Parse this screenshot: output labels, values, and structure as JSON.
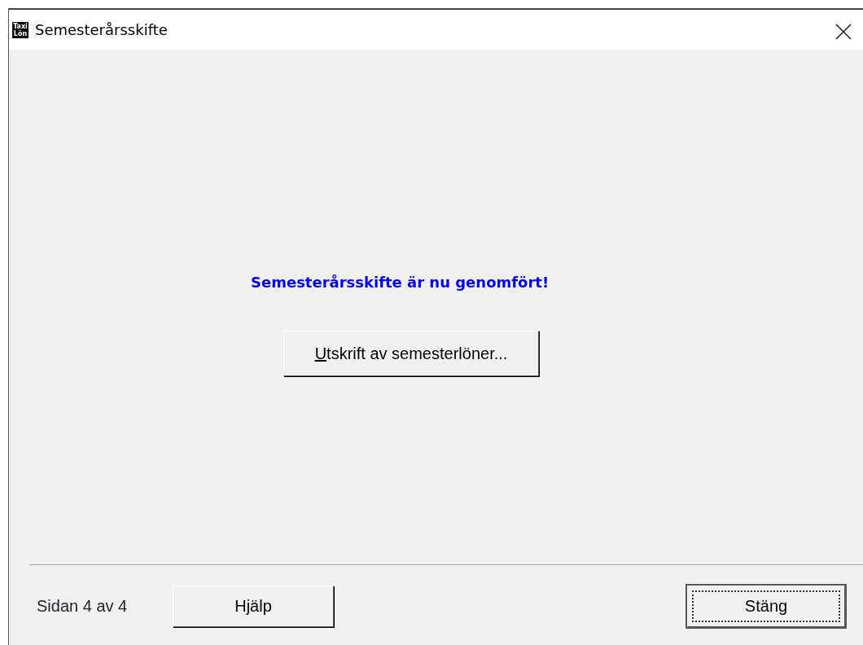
{
  "window": {
    "icon_text": [
      "Taxi",
      "Lön"
    ],
    "title": "Semesterårsskifte"
  },
  "message": "Semesterårsskifte är nu genomfört!",
  "action_button": {
    "label": "Utskrift av semesterlöner...",
    "first_letter_underlined": true
  },
  "footer": {
    "page_info": "Sidan 4 av 4",
    "buttons": [
      {
        "label": "Hjälp",
        "default": false
      },
      {
        "label": "Stäng",
        "default": true
      }
    ]
  }
}
